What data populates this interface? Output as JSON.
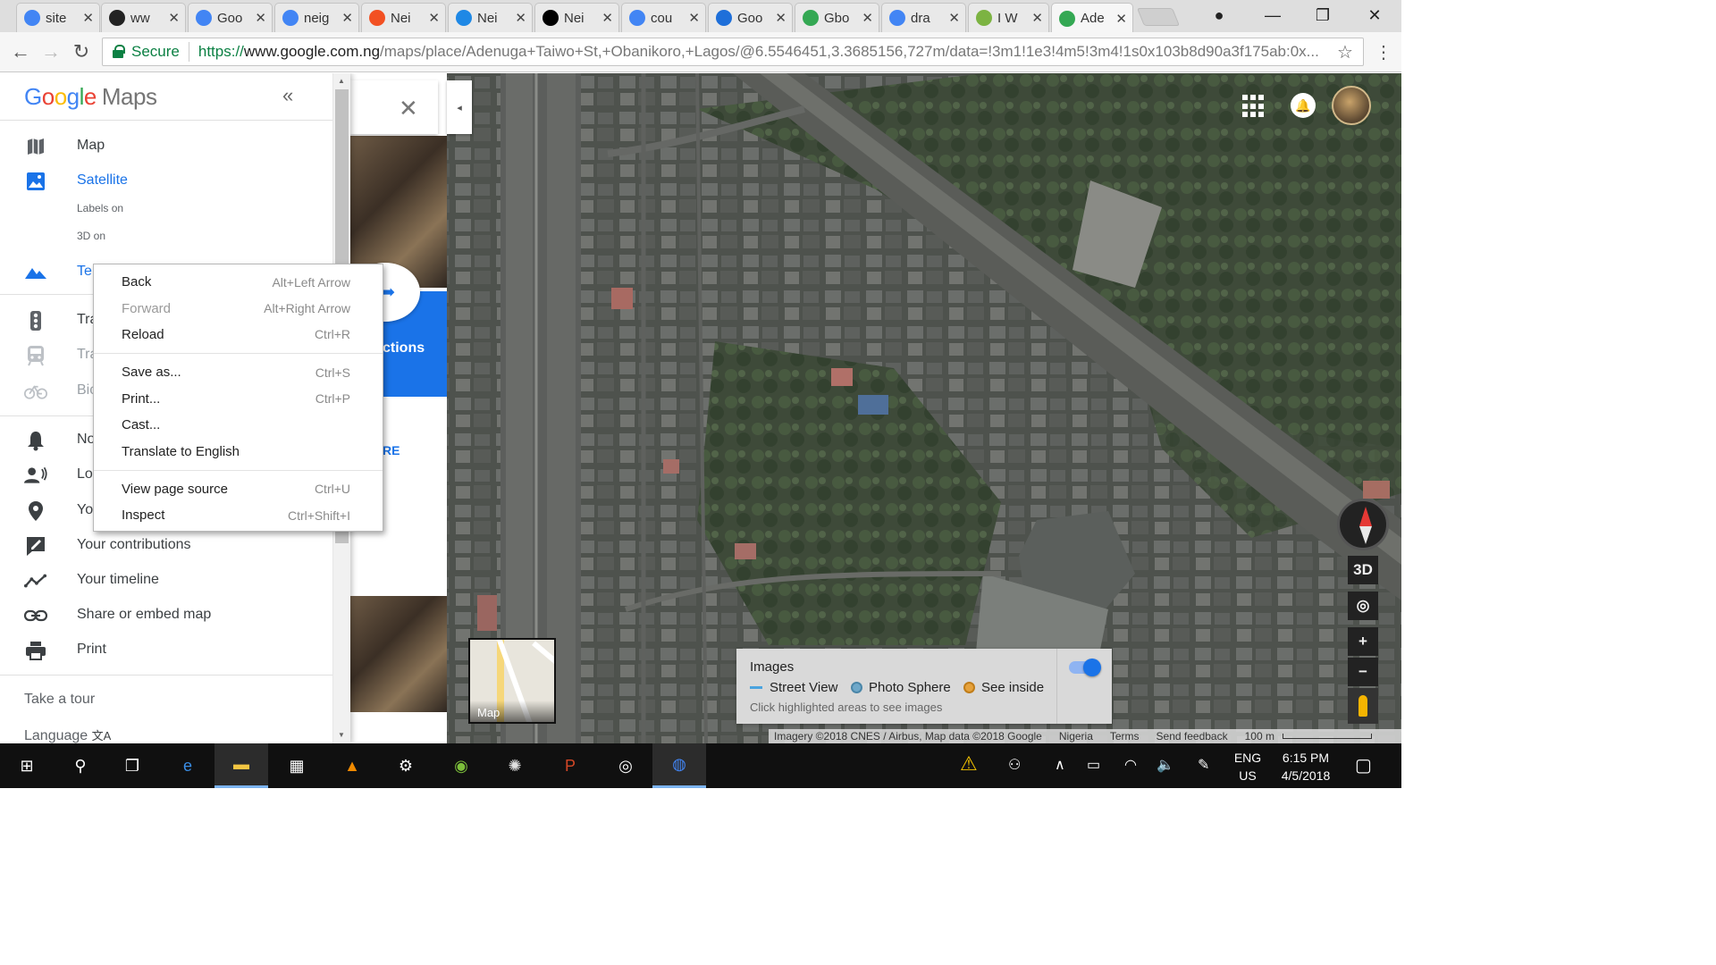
{
  "browser": {
    "tabs": [
      {
        "title": "site",
        "favicon": "google-icon",
        "color": "#4285f4"
      },
      {
        "title": "ww",
        "favicon": "pinterest-icon",
        "color": "#222222"
      },
      {
        "title": "Goo",
        "favicon": "google-icon",
        "color": "#4285f4"
      },
      {
        "title": "neig",
        "favicon": "google-icon",
        "color": "#4285f4"
      },
      {
        "title": "Nei",
        "favicon": "microsoft-icon",
        "color": "#f25022"
      },
      {
        "title": "Nei",
        "favicon": "edit-icon",
        "color": "#1e88e5"
      },
      {
        "title": "Nei",
        "favicon": "wikipedia-icon",
        "color": "#000000"
      },
      {
        "title": "cou",
        "favicon": "google-icon",
        "color": "#4285f4"
      },
      {
        "title": "Goo",
        "favicon": "edge-icon",
        "color": "#1e6fd9"
      },
      {
        "title": "Gbo",
        "favicon": "maps-icon",
        "color": "#34a853"
      },
      {
        "title": "dra",
        "favicon": "google-icon",
        "color": "#4285f4"
      },
      {
        "title": "I W",
        "favicon": "leaf-icon",
        "color": "#7cb342"
      },
      {
        "title": "Ade",
        "favicon": "maps-icon",
        "color": "#34a853",
        "active": true
      }
    ],
    "close_glyph": "✕",
    "window_controls": {
      "minimize": "—",
      "maximize": "❐",
      "close": "✕"
    },
    "profile_glyph": "●",
    "nav": {
      "back": "←",
      "forward": "→",
      "reload": "↻"
    },
    "secure_label": "Secure",
    "url_scheme": "https://",
    "url_host": "www.google.com.ng",
    "url_path": "/maps/place/Adenuga+Taiwo+St,+Obanikoro,+Lagos/@6.5546451,3.3685156,727m/data=!3m1!1e3!4m5!3m4!1s0x103b8d90a3f175ab:0x...",
    "star_glyph": "☆",
    "menu_glyph": "⋮"
  },
  "drawer": {
    "logo": {
      "g1": "G",
      "g2": "o",
      "g3": "o",
      "g4": "g",
      "g5": "l",
      "g6": "e",
      "maps": "Maps"
    },
    "collapse_glyph": "«",
    "items": [
      {
        "label": "Map",
        "icon": "map-icon"
      },
      {
        "label": "Satellite",
        "icon": "satellite-icon"
      },
      {
        "label": "Te",
        "icon": "terrain-icon"
      },
      {
        "label": "Tra",
        "icon": "traffic-icon"
      },
      {
        "label": "Tra",
        "icon": "transit-icon"
      },
      {
        "label": "Bic",
        "icon": "bicycle-icon"
      },
      {
        "label": "No",
        "icon": "notifications-icon"
      },
      {
        "label": "Lo",
        "icon": "location-sharing-icon"
      },
      {
        "label": "Yo",
        "icon": "your-places-icon"
      },
      {
        "label": "Your contributions",
        "icon": "contributions-icon"
      },
      {
        "label": "Your timeline",
        "icon": "timeline-icon"
      },
      {
        "label": "Share or embed map",
        "icon": "link-icon"
      },
      {
        "label": "Print",
        "icon": "printer-icon"
      }
    ],
    "sub_labels_on": "Labels on",
    "sub_3d_on": "3D on",
    "take_tour": "Take a tour",
    "language": "Language",
    "language_glyph": "文A"
  },
  "context_menu": {
    "items": [
      {
        "label": "Back",
        "shortcut": "Alt+Left Arrow"
      },
      {
        "label": "Forward",
        "shortcut": "Alt+Right Arrow"
      },
      {
        "label": "Reload",
        "shortcut": "Ctrl+R"
      },
      {
        "label": "Save as...",
        "shortcut": "Ctrl+S"
      },
      {
        "label": "Print...",
        "shortcut": "Ctrl+P"
      },
      {
        "label": "Cast...",
        "shortcut": ""
      },
      {
        "label": "Translate to English",
        "shortcut": ""
      },
      {
        "label": "View page source",
        "shortcut": "Ctrl+U"
      },
      {
        "label": "Inspect",
        "shortcut": "Ctrl+Shift+I"
      }
    ]
  },
  "place_panel": {
    "directions_fragment": "ctions",
    "more_fragment": "RE",
    "close_glyph": "✕",
    "collapse_glyph": "◂"
  },
  "map": {
    "minimap_label": "Map",
    "images_card": {
      "title": "Images",
      "legend": [
        {
          "label": "Street View",
          "color": "#4aa3df"
        },
        {
          "label": "Photo Sphere",
          "color": "#6fa8c9"
        },
        {
          "label": "See inside",
          "color": "#e6a23c"
        }
      ],
      "hint": "Click highlighted areas to see images",
      "toggle_on": true
    },
    "controls": {
      "three_d": "3D",
      "locate": "◎",
      "zoom_in": "+",
      "zoom_out": "−",
      "notif_glyph": "🔔"
    },
    "attribution": {
      "imagery": "Imagery ©2018 CNES / Airbus, Map data ©2018 Google",
      "country": "Nigeria",
      "terms": "Terms",
      "feedback": "Send feedback",
      "scale": "100 m"
    }
  },
  "taskbar": {
    "apps": [
      {
        "name": "start-icon",
        "glyph": "⊞"
      },
      {
        "name": "search-icon",
        "glyph": "⚲"
      },
      {
        "name": "task-view-icon",
        "glyph": "❐"
      },
      {
        "name": "edge-icon",
        "glyph": "e"
      },
      {
        "name": "file-explorer-icon",
        "glyph": "▬"
      },
      {
        "name": "store-icon",
        "glyph": "▦"
      },
      {
        "name": "vlc-icon",
        "glyph": "▲"
      },
      {
        "name": "settings-icon",
        "glyph": "⚙"
      },
      {
        "name": "android-studio-icon",
        "glyph": "◉"
      },
      {
        "name": "cog-app-icon",
        "glyph": "✺"
      },
      {
        "name": "powerpoint-icon",
        "glyph": "P"
      },
      {
        "name": "media-icon",
        "glyph": "◎"
      },
      {
        "name": "chrome-icon",
        "glyph": "◍"
      }
    ],
    "tray": {
      "people": "⚇",
      "chevron": "∧",
      "battery": "▭",
      "wifi": "◠",
      "volume": "🔈",
      "pen": "✎",
      "notifications": "▢"
    },
    "language": {
      "line1": "ENG",
      "line2": "US"
    },
    "time": "6:15 PM",
    "date": "4/5/2018"
  }
}
